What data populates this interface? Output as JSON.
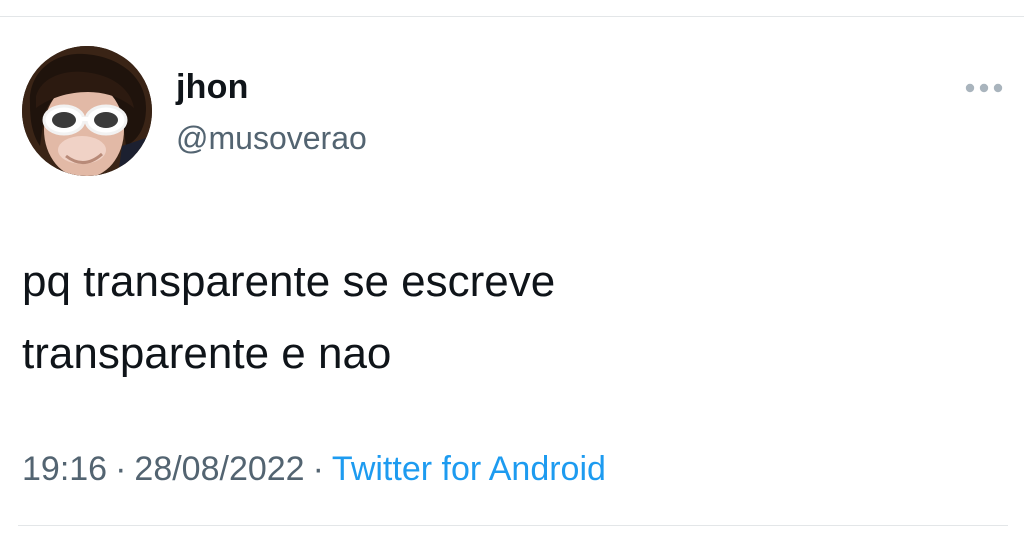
{
  "tweet": {
    "author": {
      "display_name": "jhon",
      "handle": "@musoverao"
    },
    "text_lines": [
      "pq transparente se escreve",
      "transparente e nao"
    ],
    "time": "19:16",
    "date": "28/08/2022",
    "separator": "·",
    "source": "Twitter for Android"
  },
  "colors": {
    "text_primary": "#0f1419",
    "text_secondary": "#536471",
    "link": "#1d9bf0",
    "divider": "#e3e6e8",
    "background": "#ffffff"
  },
  "icons": {
    "more": "more-horizontal-icon",
    "avatar": "avatar-image"
  }
}
